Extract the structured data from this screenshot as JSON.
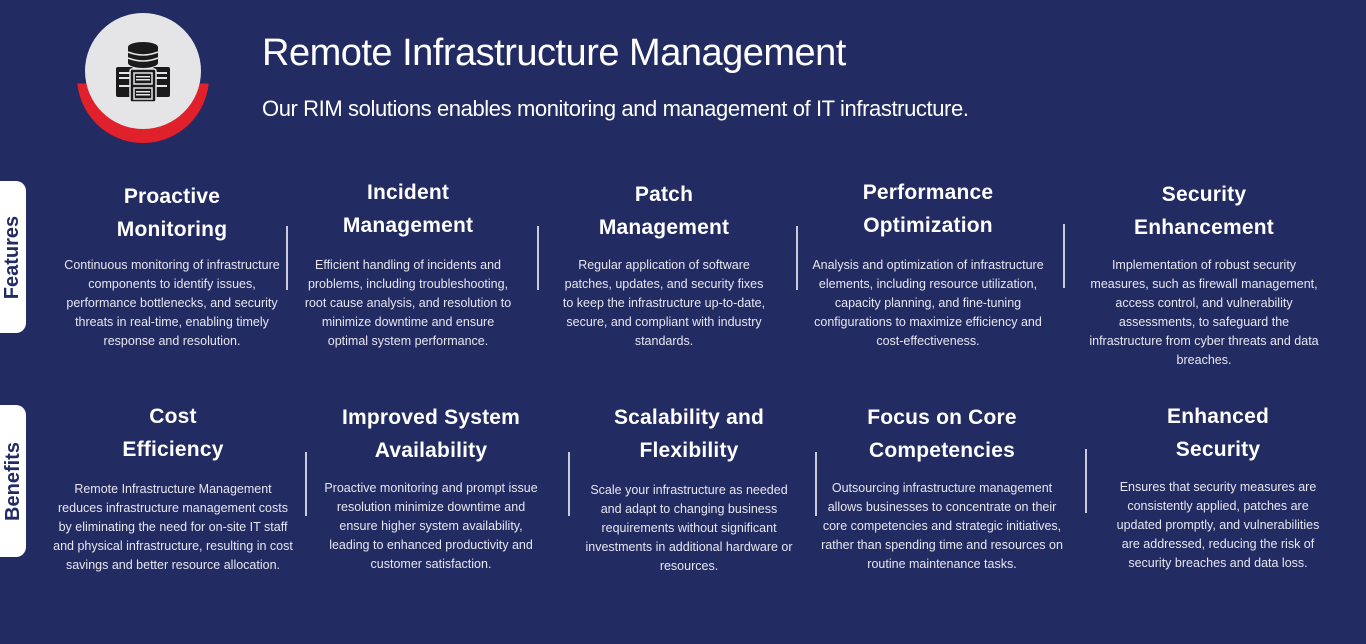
{
  "header": {
    "title": "Remote Infrastructure Management",
    "subtitle": "Our RIM solutions enables monitoring and management of IT infrastructure.",
    "logo_icon": "server-database-icon"
  },
  "colors": {
    "background": "#232b63",
    "accent_red": "#e0202a",
    "logo_bg": "#e5e5e7",
    "text": "#ffffff"
  },
  "sections": {
    "features": {
      "label": "Features",
      "items": [
        {
          "title": "Proactive Monitoring",
          "title_lines": [
            "Proactive",
            "Monitoring"
          ],
          "description": "Continuous monitoring of infrastructure components to identify issues, performance bottlenecks, and security threats in real-time, enabling timely response and resolution."
        },
        {
          "title": "Incident Management",
          "title_lines": [
            "Incident",
            "Management"
          ],
          "description": "Efficient handling of incidents and problems, including troubleshooting, root cause analysis, and resolution to minimize downtime and ensure optimal system performance."
        },
        {
          "title": "Patch Management",
          "title_lines": [
            "Patch",
            "Management"
          ],
          "description": "Regular application of software patches, updates, and security fixes to keep the infrastructure up-to-date, secure, and compliant with industry standards."
        },
        {
          "title": "Performance Optimization",
          "title_lines": [
            "Performance",
            "Optimization"
          ],
          "description": "Analysis and optimization of infrastructure elements, including resource utilization, capacity planning, and fine-tuning configurations to maximize efficiency and cost-effectiveness."
        },
        {
          "title": "Security Enhancement",
          "title_lines": [
            "Security",
            "Enhancement"
          ],
          "description": "Implementation of robust security measures, such as firewall management, access control, and vulnerability assessments, to safeguard the infrastructure from cyber threats and data breaches."
        }
      ]
    },
    "benefits": {
      "label": "Benefits",
      "items": [
        {
          "title": "Cost Efficiency",
          "title_lines": [
            "Cost",
            "Efficiency"
          ],
          "description": "Remote Infrastructure Management reduces infrastructure management costs by eliminating the need for on-site IT staff and physical infrastructure, resulting in cost savings and better resource allocation."
        },
        {
          "title": "Improved System Availability",
          "title_lines": [
            "Improved System",
            "Availability"
          ],
          "description": "Proactive monitoring and prompt issue resolution minimize downtime and ensure higher system availability, leading to enhanced productivity and customer satisfaction."
        },
        {
          "title": "Scalability and Flexibility",
          "title_lines": [
            "Scalability and",
            "Flexibility"
          ],
          "description": "Scale your infrastructure as needed and adapt to changing business requirements without significant investments in additional hardware or resources."
        },
        {
          "title": "Focus on Core Competencies",
          "title_lines": [
            "Focus on Core",
            "Competencies"
          ],
          "description": "Outsourcing infrastructure management allows businesses to concentrate on their core competencies and strategic initiatives, rather than spending time and resources on routine maintenance tasks."
        },
        {
          "title": "Enhanced Security",
          "title_lines": [
            "Enhanced",
            "Security"
          ],
          "description": "Ensures that security measures are consistently applied, patches are updated promptly, and vulnerabilities are addressed, reducing the risk of security breaches and data loss."
        }
      ]
    }
  }
}
